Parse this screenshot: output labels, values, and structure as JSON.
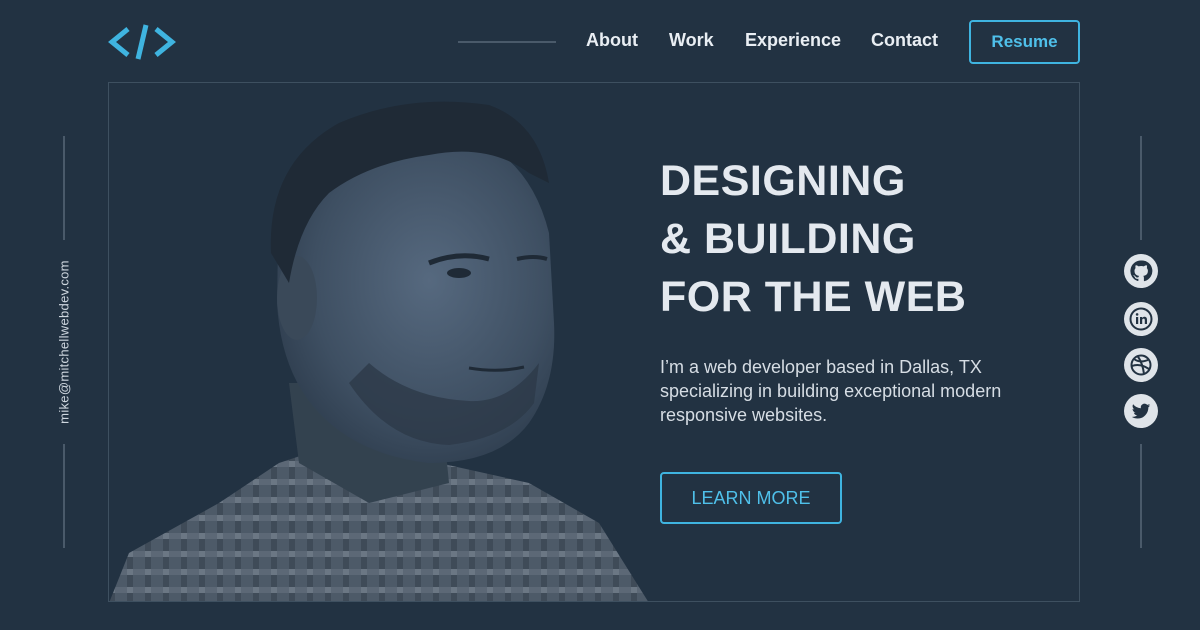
{
  "header": {
    "logo_icon": "code-brackets-icon",
    "nav": [
      "About",
      "Work",
      "Experience",
      "Contact"
    ],
    "resume_label": "Resume"
  },
  "hero": {
    "title_lines": [
      "DESIGNING",
      "& BUILDING",
      "FOR THE WEB"
    ],
    "description": "I’m a web developer based in Dallas, TX specializing in building exceptional modern responsive websites.",
    "cta_label": "LEARN MORE"
  },
  "sidebar_left": {
    "email": "mike@mitchellwebdev.com"
  },
  "sidebar_right": {
    "socials": [
      "github-icon",
      "linkedin-icon",
      "dribbble-icon",
      "twitter-icon"
    ]
  },
  "colors": {
    "background": "#223242",
    "accent": "#3fb4e0",
    "text": "#e4e9ef"
  }
}
